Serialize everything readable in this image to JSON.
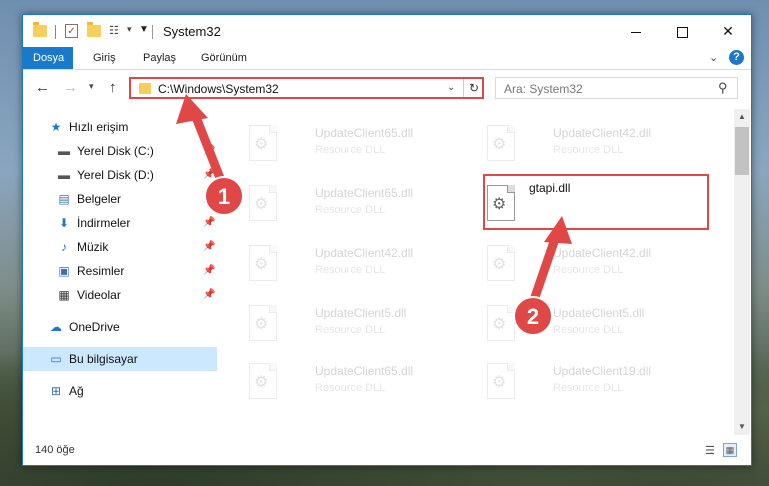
{
  "window": {
    "title": "System32"
  },
  "ribbon": {
    "tabs": [
      "Dosya",
      "Giriş",
      "Paylaş",
      "Görünüm"
    ],
    "help": "?"
  },
  "nav": {
    "address": "C:\\Windows\\System32",
    "search_placeholder": "Ara: System32"
  },
  "sidebar": {
    "items": [
      {
        "label": "Hızlı erişim",
        "icon": "star-icon"
      },
      {
        "label": "Yerel Disk (C:)",
        "icon": "drive-icon"
      },
      {
        "label": "Yerel Disk (D:)",
        "icon": "drive-icon"
      },
      {
        "label": "Belgeler",
        "icon": "documents-icon"
      },
      {
        "label": "İndirmeler",
        "icon": "download-icon"
      },
      {
        "label": "Müzik",
        "icon": "music-icon"
      },
      {
        "label": "Resimler",
        "icon": "pictures-icon"
      },
      {
        "label": "Videolar",
        "icon": "videos-icon"
      },
      {
        "label": "OneDrive",
        "icon": "cloud-icon"
      },
      {
        "label": "Bu bilgisayar",
        "icon": "computer-icon"
      },
      {
        "label": "Ağ",
        "icon": "network-icon"
      }
    ]
  },
  "files": [
    {
      "name": "UpdateClient65.dll",
      "type": "Resource DLL"
    },
    {
      "name": "UpdateClient42.dll",
      "type": "Resource DLL"
    },
    {
      "name": "UpdateClient65.dll",
      "type": "Resource DLL"
    },
    {
      "name": "gtapi.dll",
      "type": ""
    },
    {
      "name": "UpdateClient42.dll",
      "type": "Resource DLL"
    },
    {
      "name": "UpdateClient42.dll",
      "type": "Resource DLL"
    },
    {
      "name": "UpdateClient5.dll",
      "type": "Resource DLL"
    },
    {
      "name": "UpdateClient5.dll",
      "type": "Resource DLL"
    },
    {
      "name": "UpdateClient65.dll",
      "type": "Resource DLL"
    },
    {
      "name": "UpdateClient19.dll",
      "type": "Resource DLL"
    }
  ],
  "annotations": {
    "step1": "1",
    "step2": "2",
    "color": "#e04848"
  },
  "status": {
    "count": "140 öğe"
  },
  "colors": {
    "accent": "#1979ca",
    "highlight": "#e04848",
    "selected": "#cce8ff"
  }
}
